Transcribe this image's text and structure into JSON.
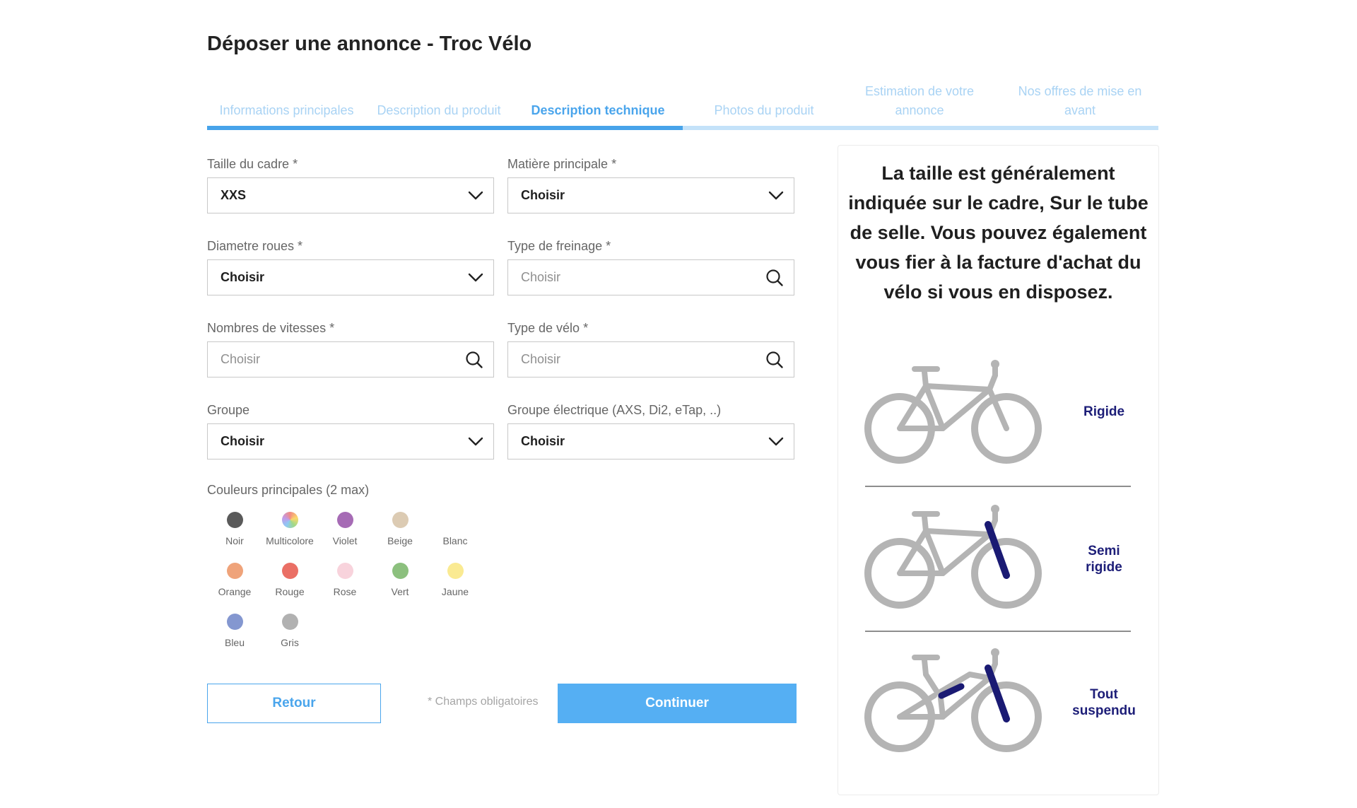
{
  "page": {
    "title": "Déposer une annonce - Troc Vélo"
  },
  "stepper": {
    "steps": [
      {
        "label": "Informations principales",
        "active": false
      },
      {
        "label": "Description du produit",
        "active": false
      },
      {
        "label": "Description technique",
        "active": true
      },
      {
        "label": "Photos du produit",
        "active": false
      },
      {
        "label": "Estimation de votre annonce",
        "active": false
      },
      {
        "label": "Nos offres de mise en avant",
        "active": false
      }
    ],
    "progress_percent": 50
  },
  "form": {
    "frame_size": {
      "label": "Taille du cadre *",
      "value": "XXS"
    },
    "main_material": {
      "label": "Matière principale *",
      "value": "Choisir"
    },
    "wheel_diameter": {
      "label": "Diametre roues *",
      "value": "Choisir"
    },
    "brake_type": {
      "label": "Type de freinage *",
      "placeholder": "Choisir"
    },
    "speeds": {
      "label": "Nombres de vitesses *",
      "placeholder": "Choisir"
    },
    "bike_type": {
      "label": "Type de vélo *",
      "placeholder": "Choisir"
    },
    "groupset": {
      "label": "Groupe",
      "value": "Choisir"
    },
    "electric_groupset": {
      "label": "Groupe électrique (AXS, Di2, eTap, ..)",
      "value": "Choisir"
    }
  },
  "colors": {
    "label": "Couleurs principales (2 max)",
    "items": [
      {
        "name": "Noir",
        "hex": "#5a5a5a"
      },
      {
        "name": "Multicolore",
        "hex": "multicolor"
      },
      {
        "name": "Violet",
        "hex": "#a66bb5"
      },
      {
        "name": "Beige",
        "hex": "#dccbb3"
      },
      {
        "name": "Blanc",
        "hex": "#ffffff"
      },
      {
        "name": "Orange",
        "hex": "#efa37a"
      },
      {
        "name": "Rouge",
        "hex": "#ea6f65"
      },
      {
        "name": "Rose",
        "hex": "#f8d3dc"
      },
      {
        "name": "Vert",
        "hex": "#8cc07e"
      },
      {
        "name": "Jaune",
        "hex": "#faea92"
      },
      {
        "name": "Bleu",
        "hex": "#8497d0"
      },
      {
        "name": "Gris",
        "hex": "#b1b1b1"
      }
    ]
  },
  "actions": {
    "back_label": "Retour",
    "required_note": "* Champs obligatoires",
    "continue_label": "Continuer"
  },
  "info": {
    "text": "La taille est généralement indiquée sur le cadre, Sur le tube de selle. Vous pouvez également vous fier à la facture d'achat du vélo si vous en disposez.",
    "bikes": [
      {
        "label": "Rigide"
      },
      {
        "label": "Semi rigide"
      },
      {
        "label": "Tout suspendu"
      }
    ]
  },
  "theme": {
    "accent": "#4aa5ec",
    "accent_light": "#c4e2f9",
    "bike_gray": "#b4b4b4",
    "suspension_navy": "#1a1a73"
  }
}
